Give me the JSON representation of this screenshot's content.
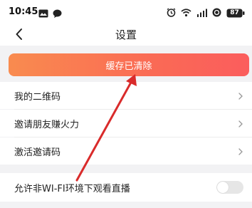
{
  "status_bar": {
    "time": "10:45",
    "battery": "87",
    "left_icons": [
      "gallery-icon",
      "chat-bubble-icon"
    ],
    "right_icons": [
      "alarm-icon",
      "wifi-icon",
      "signal-icon",
      "nfc-icon",
      "battery-icon"
    ]
  },
  "header": {
    "title": "设置",
    "back_icon": "chevron-left-icon"
  },
  "toast": {
    "message": "缓存已清除",
    "gradient": [
      "#f98b4f",
      "#fb5d5d"
    ]
  },
  "menu": {
    "items": [
      {
        "label": "我的二维码"
      },
      {
        "label": "邀请朋友赚火力"
      },
      {
        "label": "激活邀请码"
      }
    ]
  },
  "settings": {
    "live_non_wifi": {
      "label": "允许非WI-FI环境下观看直播",
      "enabled": false
    }
  },
  "annotation": {
    "color": "#d92b2b",
    "shape": "arrow"
  }
}
